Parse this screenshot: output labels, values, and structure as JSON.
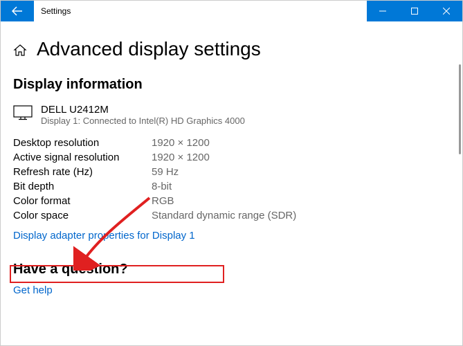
{
  "window": {
    "title": "Settings"
  },
  "page": {
    "heading": "Advanced display settings"
  },
  "section": {
    "heading": "Display information"
  },
  "monitor": {
    "name": "DELL U2412M",
    "subtext": "Display 1: Connected to Intel(R) HD Graphics 4000"
  },
  "props": {
    "desktop_res_label": "Desktop resolution",
    "desktop_res_value": "1920 × 1200",
    "active_res_label": "Active signal resolution",
    "active_res_value": "1920 × 1200",
    "refresh_label": "Refresh rate (Hz)",
    "refresh_value": "59 Hz",
    "bitdepth_label": "Bit depth",
    "bitdepth_value": "8-bit",
    "colorfmt_label": "Color format",
    "colorfmt_value": "RGB",
    "colorspace_label": "Color space",
    "colorspace_value": "Standard dynamic range (SDR)"
  },
  "link": {
    "adapter": "Display adapter properties for Display 1",
    "help": "Get help"
  },
  "question": {
    "heading": "Have a question?"
  }
}
